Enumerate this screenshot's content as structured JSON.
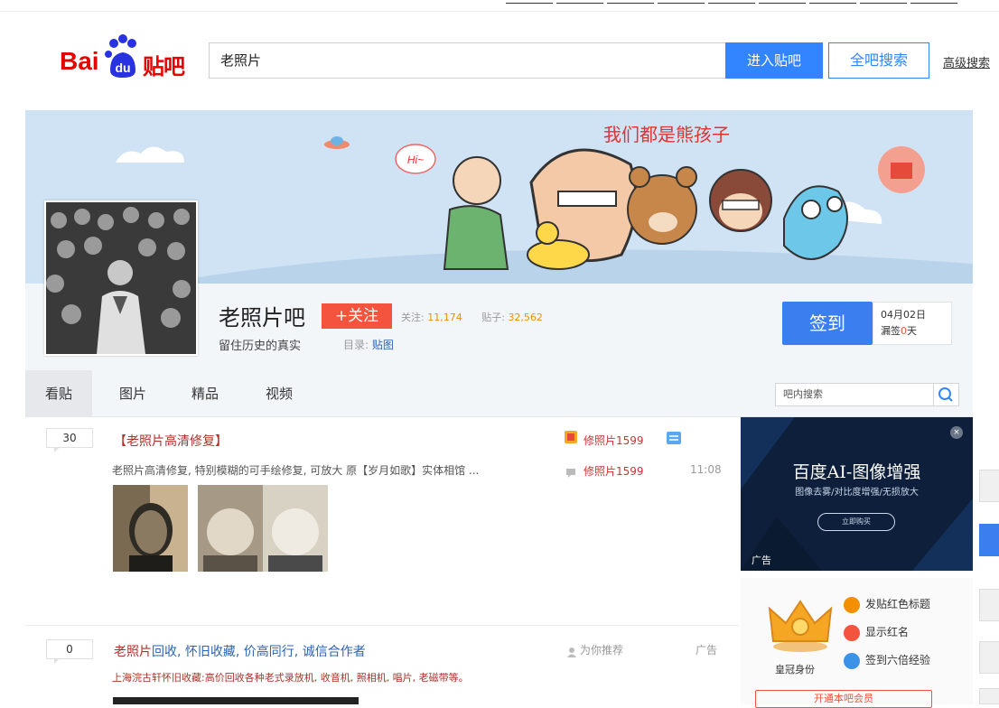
{
  "header": {
    "logo_text_bai": "Bai",
    "logo_text_du": "du",
    "logo_text_tieba": "贴吧",
    "search_value": "老照片",
    "enter_button": "进入贴吧",
    "all_search_button": "全吧搜索",
    "advanced_search": "高级搜索"
  },
  "banner": {
    "slogan_art": "我们都是熊孩子",
    "bubble": "Hi~"
  },
  "forum": {
    "name": "老照片吧",
    "follow_button": "+关注",
    "followers_label": "关注:",
    "followers": "11,174",
    "posts_label": "贴子:",
    "posts": "32,562",
    "slogan": "留住历史的真实",
    "catalog_label": "目录:",
    "catalog_link": "贴图"
  },
  "sign": {
    "button": "签到",
    "date": "04月02日",
    "missed_prefix": "漏签",
    "missed_days": "0",
    "missed_suffix": "天"
  },
  "tabs": [
    "看贴",
    "图片",
    "精品",
    "视频"
  ],
  "inner_search": {
    "placeholder": "吧内搜索"
  },
  "threads": [
    {
      "replies": "30",
      "title": "【老照片高清修复】",
      "abstract": "老照片高清修复, 特别模糊的可手绘修复, 可放大 原【岁月如歌】实体相馆 ...",
      "author": "修照片1599",
      "last_reply": "修照片1599",
      "time": "11:08"
    },
    {
      "replies": "0",
      "title_red": "老照片",
      "title_rest": "回收, 怀旧收藏, 价高同行, 诚信合作者",
      "abstract_red": "上海",
      "abstract_rest": "浣古轩怀旧收藏:高价回收各种老式录放机, 收音机, 照相机, 唱片, 老磁带等。",
      "recommend": "为你推荐",
      "ad_tag": "广告"
    }
  ],
  "ad": {
    "title": "百度AI-图像增强",
    "subtitle": "图像去雾/对比度增强/无损放大",
    "button": "立即购买",
    "label": "广告",
    "close": "×"
  },
  "vip": {
    "name": "皇冠身份",
    "perks": [
      "发贴红色标题",
      "显示红名",
      "签到六倍经验"
    ],
    "footer": "开通本吧会员",
    "colors": [
      "#f38f00",
      "#f4533e",
      "#3b93e8"
    ]
  },
  "top_nav_count": 9
}
